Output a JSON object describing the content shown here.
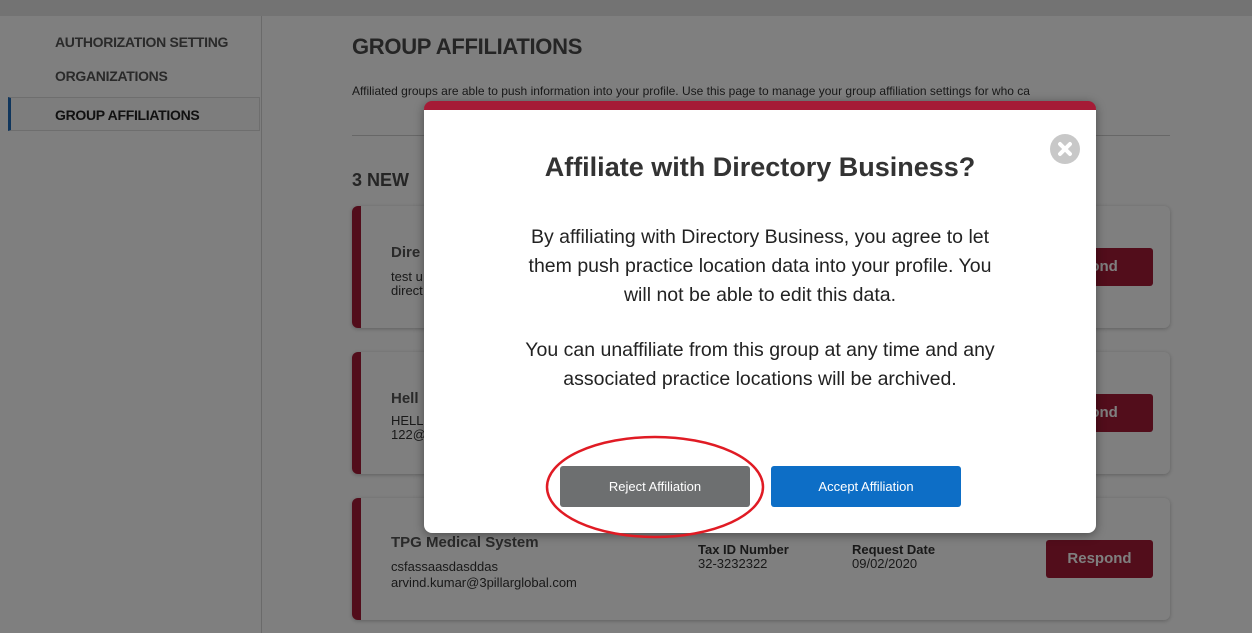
{
  "sidebar": {
    "items": [
      {
        "label": "AUTHORIZATION SETTING"
      },
      {
        "label": "ORGANIZATIONS"
      },
      {
        "label": "GROUP AFFILIATIONS"
      }
    ]
  },
  "main": {
    "title": "GROUP AFFILIATIONS",
    "description": "Affiliated groups are able to push information into your profile. Use this page to manage your group affiliation settings for who ca",
    "new_heading": "3 NEW",
    "cards": [
      {
        "name": "Dire",
        "line1": "test u",
        "line2": "direct",
        "respond_label": "pond"
      },
      {
        "name": "Hell",
        "line1": "HELL",
        "line2": "122@",
        "respond_label": "pond"
      },
      {
        "name": "TPG Medical System",
        "line1": "csfassaasdasddas",
        "line2": "arvind.kumar@3pillarglobal.com",
        "tax_label": "Tax ID Number",
        "tax_value": "32-3232322",
        "date_label": "Request Date",
        "date_value": "09/02/2020",
        "respond_label": "Respond"
      }
    ]
  },
  "modal": {
    "title": "Affiliate with Directory Business?",
    "paragraph1_lines": [
      "By affiliating with Directory Business, you agree to let",
      "them push practice location data into your profile. You",
      "will not be able to edit this data."
    ],
    "paragraph2_lines": [
      "You can unaffiliate from this group at any time and any",
      "associated practice locations will be archived."
    ],
    "reject_label": "Reject Affiliation",
    "accept_label": "Accept Affiliation",
    "close_icon": "close-icon"
  },
  "colors": {
    "brand_red": "#a51b36",
    "accept_blue": "#0d6ec6",
    "reject_gray": "#6d6f70",
    "active_nav_border": "#1e6ab8",
    "annotation_red": "#e01b24"
  }
}
